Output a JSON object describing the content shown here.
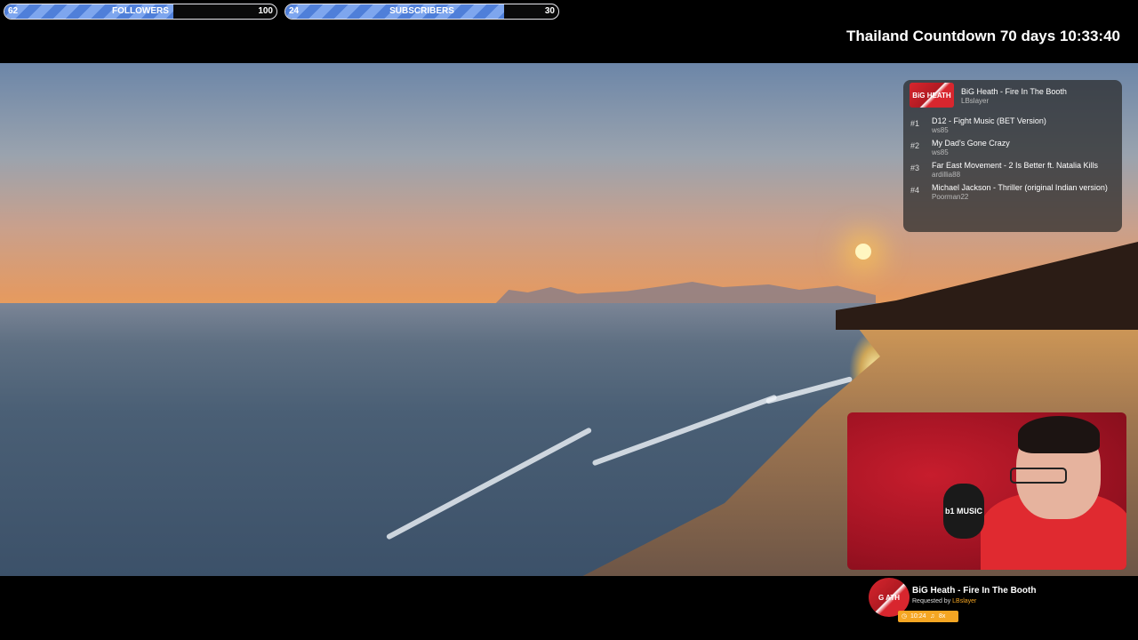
{
  "goals": {
    "followers": {
      "current": "62",
      "label": "FOLLOWERS",
      "target": "100",
      "progress": 0.62,
      "fill_color": "#4f7fd9"
    },
    "subscribers": {
      "current": "24",
      "label": "SUBSCRIBERS",
      "target": "30",
      "progress": 0.8,
      "fill_color": "#4f7fd9"
    }
  },
  "countdown": "Thailand Countdown 70 days 10:33:40",
  "queue": {
    "now": {
      "art_text": "BiG HEATH",
      "title": "BiG Heath - Fire In The Booth",
      "user": "LBslayer"
    },
    "items": [
      {
        "num": "#1",
        "title": "D12 - Fight Music (BET Version)",
        "user": "ws85"
      },
      {
        "num": "#2",
        "title": "My Dad's Gone Crazy",
        "user": "ws85"
      },
      {
        "num": "#3",
        "title": "Far East Movement - 2 Is Better ft. Natalia Kills",
        "user": "ardillia88"
      },
      {
        "num": "#4",
        "title": "Michael Jackson - Thriller (original Indian version)",
        "user": "Poorman22"
      }
    ]
  },
  "webcam": {
    "mic_text": "b1 MUSIC"
  },
  "now_playing": {
    "art_text": "G ATH",
    "title": "BiG Heath - Fire In The Booth",
    "requested_prefix": "Requested by",
    "requested_user": "LBslayer",
    "time": "10:24",
    "plays": "8x",
    "accent_color": "#f5a623"
  }
}
